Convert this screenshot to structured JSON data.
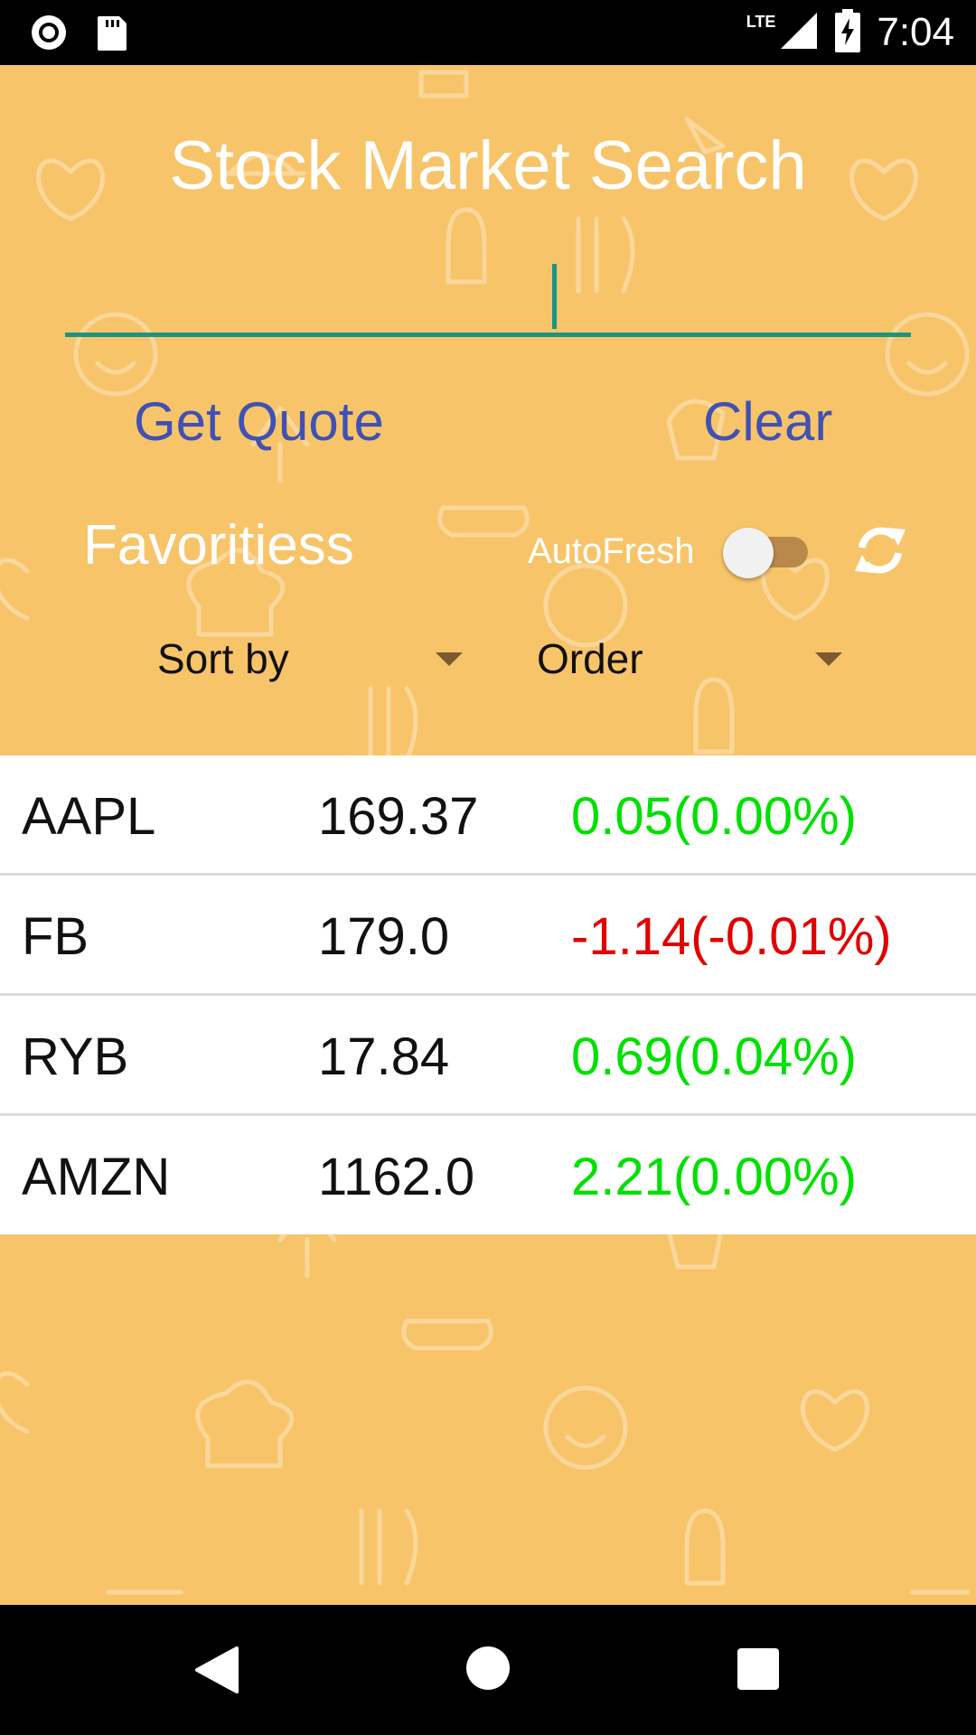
{
  "status_bar": {
    "time": "7:04",
    "network": "LTE",
    "icons": [
      "record-icon",
      "sd-card-icon",
      "signal-icon",
      "battery-charging-icon"
    ]
  },
  "app": {
    "title": "Stock Market Search",
    "background_color": "#f8c46a"
  },
  "search": {
    "value": "",
    "placeholder": "",
    "underline_color": "#1a9485"
  },
  "actions": {
    "get_quote_label": "Get Quote",
    "clear_label": "Clear",
    "label_color": "#3f51b5"
  },
  "favorites": {
    "heading": "Favoritiess",
    "autofresh_label": "AutoFresh",
    "autofresh_on": false,
    "refresh_icon": "refresh-icon",
    "sort_by_label": "Sort by",
    "order_label": "Order",
    "rows": [
      {
        "symbol": "AAPL",
        "price": "169.37",
        "change": "0.05(0.00%)",
        "direction": "up"
      },
      {
        "symbol": "FB",
        "price": "179.0",
        "change": "-1.14(-0.01%)",
        "direction": "down"
      },
      {
        "symbol": "RYB",
        "price": "17.84",
        "change": "0.69(0.04%)",
        "direction": "up"
      },
      {
        "symbol": "AMZN",
        "price": "1162.0",
        "change": "2.21(0.00%)",
        "direction": "up"
      }
    ],
    "colors": {
      "up": "#00e000",
      "down": "#e00000"
    }
  },
  "nav_bar": {
    "icons": [
      "back-icon",
      "home-icon",
      "recents-icon"
    ]
  }
}
